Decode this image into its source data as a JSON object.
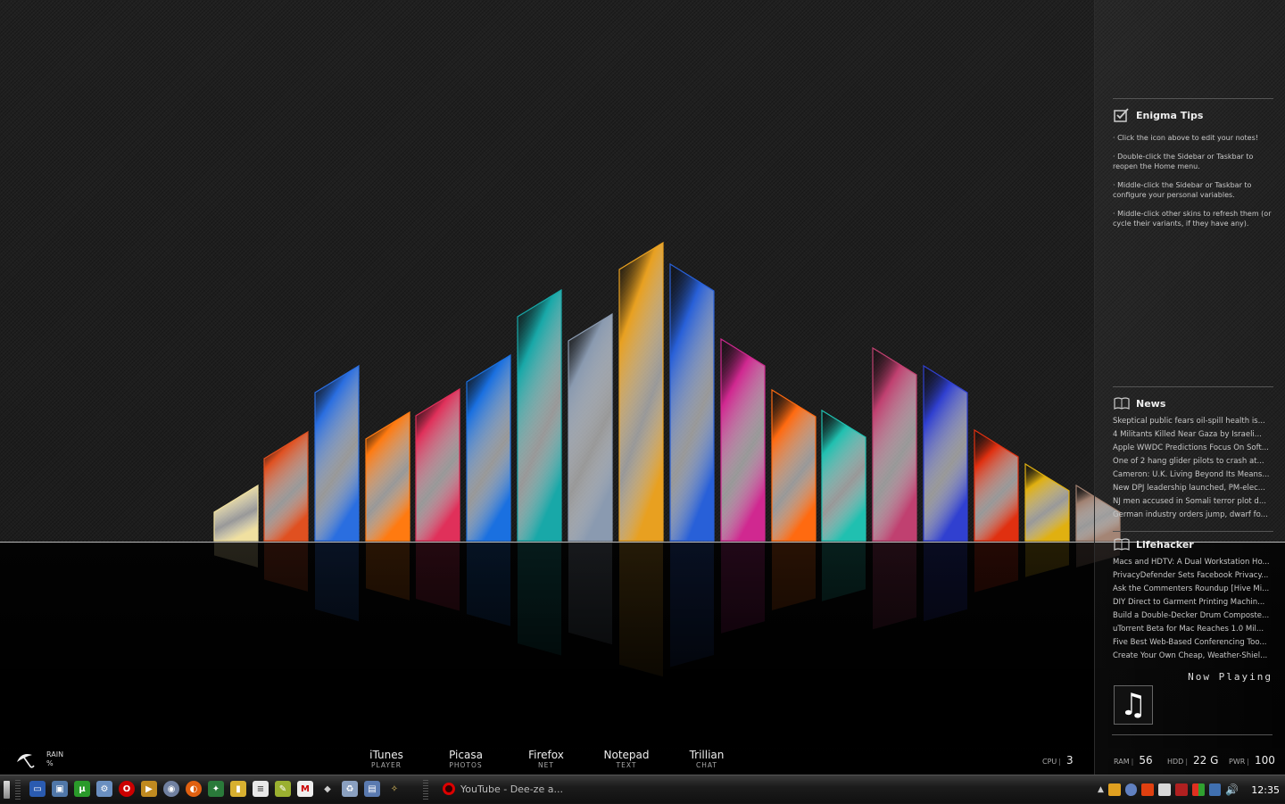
{
  "sidebar": {
    "tips": {
      "title": "Enigma Tips",
      "lines": [
        "· Click the icon above to edit your notes!",
        "· Double-click the Sidebar or Taskbar to reopen the Home menu.",
        "· Middle-click the Sidebar or Taskbar to configure your personal variables.",
        "· Middle-click other skins to refresh them (or cycle their variants, if they have any)."
      ]
    },
    "news": {
      "title": "News",
      "items": [
        "Skeptical public fears oil-spill health is...",
        "4 Militants Killed Near Gaza by Israeli...",
        "Apple WWDC Predictions Focus On Soft...",
        "One of 2 hang glider pilots to crash at...",
        "Cameron: U.K. Living Beyond Its Means...",
        "New DPJ leadership launched, PM-elec...",
        "NJ men accused in Somali terror plot d...",
        "German industry orders jump, dwarf fo..."
      ]
    },
    "lifehacker": {
      "title": "Lifehacker",
      "items": [
        "Macs and HDTV: A Dual Workstation Ho...",
        "PrivacyDefender Sets Facebook Privacy...",
        "Ask the Commenters Roundup [Hive Mi...",
        "DIY Direct to Garment Printing Machin...",
        "Build a Double-Decker Drum Composte...",
        "uTorrent Beta for Mac Reaches 1.0 Mil...",
        "Five Best Web-Based Conferencing Too...",
        "Create Your Own Cheap, Weather-Shiel..."
      ]
    },
    "now_playing": {
      "label": "Now Playing",
      "icon": "music-note-icon"
    }
  },
  "launcher": [
    {
      "name": "iTunes",
      "sub": "PLAYER"
    },
    {
      "name": "Picasa",
      "sub": "PHOTOS"
    },
    {
      "name": "Firefox",
      "sub": "NET"
    },
    {
      "name": "Notepad",
      "sub": "TEXT"
    },
    {
      "name": "Trillian",
      "sub": "CHAT"
    }
  ],
  "weather": {
    "condition": "RAIN",
    "unit": "%",
    "icon": "umbrella-icon"
  },
  "stats": {
    "cpu_label": "CPU",
    "cpu_value": "3",
    "ram_label": "RAM",
    "ram_value": "56",
    "hdd_label": "HDD",
    "hdd_value": "22 G",
    "pwr_label": "PWR",
    "pwr_value": "100"
  },
  "taskbar": {
    "task_title": "YouTube - Dee-ze a...",
    "clock": "12:35",
    "tray_expand": "▲"
  },
  "colors": {
    "crystals": [
      "#f0e0a0",
      "#e05020",
      "#2a6ee0",
      "#ff7a10",
      "#e0305a",
      "#1a70e0",
      "#18a8a8",
      "#8a9ab0",
      "#e8a020",
      "#2860d8",
      "#d02890",
      "#ff6a10",
      "#20c0b0",
      "#c04070",
      "#3040d0",
      "#e03010",
      "#e0b010",
      "#a08070"
    ]
  }
}
